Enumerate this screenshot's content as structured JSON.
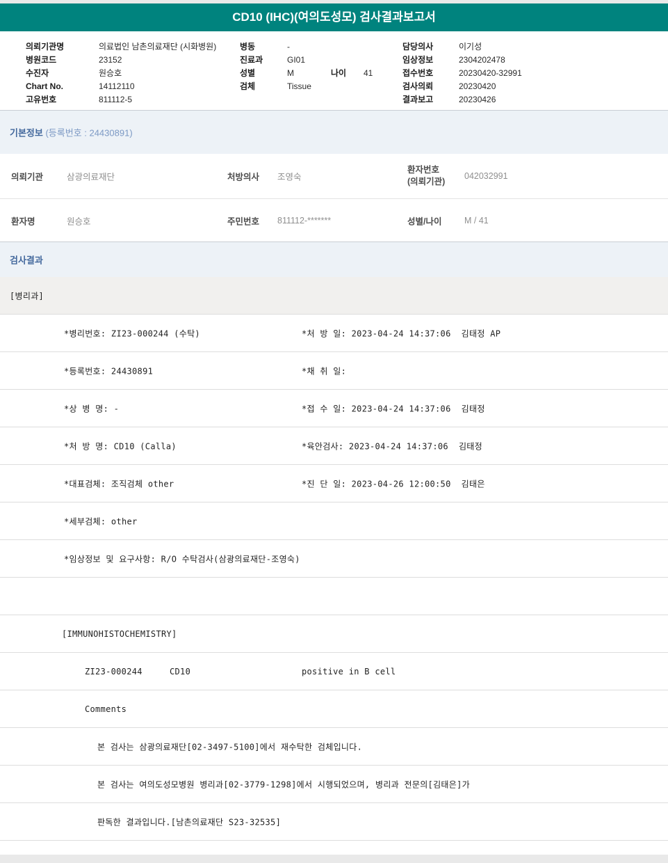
{
  "colors": {
    "accent_teal": "#00837E",
    "section_bar_bg": "#EDF2F7",
    "section_title_blue": "#44699D",
    "dept_row_bg": "#F1F0EE"
  },
  "title": "CD10 (IHC)(여의도성모) 검사결과보고서",
  "id_header": {
    "left": [
      {
        "label": "의뢰기관명",
        "value": "의료법인 남촌의료재단 (시화병원)"
      },
      {
        "label": "병원코드",
        "value": "23152"
      },
      {
        "label": "수진자",
        "value": "원승호"
      },
      {
        "label": "Chart No.",
        "value": "14112110"
      },
      {
        "label": "고유번호",
        "value": "811112-5"
      }
    ],
    "middle": [
      {
        "label": "병동",
        "value": "-"
      },
      {
        "label": "진료과",
        "value": "GI01"
      },
      {
        "label": "성별",
        "value": "M"
      },
      {
        "label": "검체",
        "value": "Tissue"
      }
    ],
    "age": {
      "label": "나이",
      "value": "41"
    },
    "right": [
      {
        "label": "담당의사",
        "value": "이기성"
      },
      {
        "label": "임상정보",
        "value": "2304202478"
      },
      {
        "label": "접수번호",
        "value": "20230420-32991"
      },
      {
        "label": "검사의뢰",
        "value": "20230420"
      },
      {
        "label": "결과보고",
        "value": "20230426"
      }
    ]
  },
  "basic_info": {
    "bar_title": "기본정보",
    "bar_sub": "(등록번호 : 24430891)",
    "row1": {
      "c1_label": "의뢰기관",
      "c1_value": "삼광의료재단",
      "c2_label": "처방의사",
      "c2_value": "조영숙",
      "c3_label_line1": "환자번호",
      "c3_label_line2": "(의뢰기관)",
      "c3_value": "042032991"
    },
    "row2": {
      "c1_label": "환자명",
      "c1_value": "원승호",
      "c2_label": "주민번호",
      "c2_value": "811112-*******",
      "c3_label": "성별/나이",
      "c3_value": "M / 41"
    }
  },
  "results": {
    "bar_title": "검사결과",
    "dept": "[병리과]",
    "report_rows": [
      {
        "cells": [
          "*병리번호: ZI23-000244 (수탁)",
          "*처 방 일: 2023-04-24 14:37:06  김태정 AP"
        ]
      },
      {
        "cells": [
          "*등록번호: 24430891",
          "*채 취 일:"
        ]
      },
      {
        "cells": [
          "*상 병 명: -",
          "*접 수 일: 2023-04-24 14:37:06  김태정"
        ]
      },
      {
        "cells": [
          "*처 방 명: CD10 (Calla)",
          "*육안검사: 2023-04-24 14:37:06  김태정"
        ]
      },
      {
        "cells": [
          "*대표검체: 조직검체 other",
          "*진 단 일: 2023-04-26 12:00:50  김태은"
        ]
      },
      {
        "cells": [
          "*세부검체: other"
        ]
      },
      {
        "cells": [
          "*임상정보 및 요구사항: R/O 수탁검사(삼광의료재단-조영숙)"
        ]
      },
      {
        "cells": []
      },
      {
        "cells": [
          "[IMMUNOHISTOCHEMISTRY]"
        ]
      },
      {
        "cells": [
          "ZI23-000244",
          "CD10",
          "positive in B cell"
        ]
      },
      {
        "cells": [
          "Comments"
        ]
      },
      {
        "cells": [
          "본 검사는 삼광의료재단[02-3497-5100]에서 재수탁한 검체입니다."
        ]
      },
      {
        "cells": [
          "본 검사는 여의도성모병원 병리과[02-3779-1298]에서 시행되었으며, 병리과 전문의[김태은]가"
        ]
      },
      {
        "cells": [
          "판독한 결과입니다.[남촌의료재단 S23-32535]"
        ]
      }
    ]
  }
}
